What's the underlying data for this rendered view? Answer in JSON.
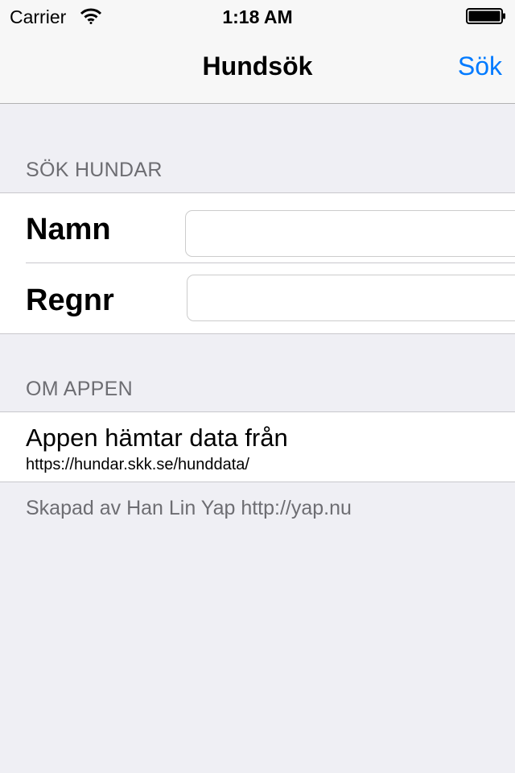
{
  "status_bar": {
    "carrier": "Carrier",
    "time": "1:18 AM"
  },
  "nav": {
    "title": "Hundsök",
    "search_button": "Sök"
  },
  "search_section": {
    "header": "SÖK HUNDAR",
    "fields": [
      {
        "label": "Namn",
        "value": ""
      },
      {
        "label": "Regnr",
        "value": ""
      }
    ]
  },
  "about_section": {
    "header": "OM APPEN",
    "title": "Appen hämtar data från",
    "url": "https://hundar.skk.se/hunddata/"
  },
  "footer": "Skapad av Han Lin Yap http://yap.nu",
  "colors": {
    "accent": "#007aff",
    "background": "#efeff4",
    "secondary_text": "#6d6d72"
  }
}
